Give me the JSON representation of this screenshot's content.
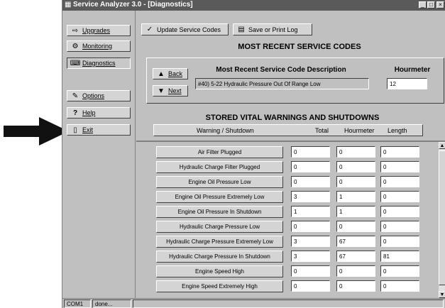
{
  "window": {
    "title": "Service Analyzer 3.0 - [Diagnostics]",
    "controls": [
      "_",
      "□",
      "×"
    ]
  },
  "sidebar": {
    "items": [
      {
        "label": "Upgrades",
        "icon": "upgrade-icon"
      },
      {
        "label": "Monitoring",
        "icon": "monitoring-icon"
      },
      {
        "label": "Diagnostics",
        "icon": "diagnostics-icon",
        "active": true
      },
      {
        "label": "Options",
        "icon": "options-icon"
      },
      {
        "label": "Help",
        "icon": "help-icon"
      },
      {
        "label": "Exit",
        "icon": "exit-icon"
      }
    ]
  },
  "toolbar": {
    "update_label": "Update Service Codes",
    "save_label": "Save or Print Log"
  },
  "codes": {
    "title": "MOST RECENT SERVICE CODES",
    "description_header": "Most Recent Service Code Description",
    "hourmeter_header": "Hourmeter",
    "back_label": "Back",
    "next_label": "Next",
    "description_value": "#40)  5-22  Hydraulic Pressure Out Of Range Low",
    "hourmeter_value": "12"
  },
  "warnings": {
    "title": "STORED VITAL WARNINGS AND SHUTDOWNS",
    "columns": [
      "Warning / Shutdown",
      "Total",
      "Hourmeter",
      "Length"
    ],
    "rows": [
      {
        "name": "Air Filter Plugged",
        "total": "0",
        "hourmeter": "0",
        "length": "0"
      },
      {
        "name": "Hydraulic Charge Filter Plugged",
        "total": "0",
        "hourmeter": "0",
        "length": "0"
      },
      {
        "name": "Engine Oil Pressure Low",
        "total": "0",
        "hourmeter": "0",
        "length": "0"
      },
      {
        "name": "Engine Oil Pressure Extremely Low",
        "total": "3",
        "hourmeter": "1",
        "length": "0"
      },
      {
        "name": "Engine Oil Pressure In Shutdown",
        "total": "1",
        "hourmeter": "1",
        "length": "0"
      },
      {
        "name": "Hydraulic Charge Pressure Low",
        "total": "0",
        "hourmeter": "0",
        "length": "0"
      },
      {
        "name": "Hydraulic Charge Pressure Extremely Low",
        "total": "3",
        "hourmeter": "67",
        "length": "0"
      },
      {
        "name": "Hydraulic Charge Pressure In Shutdown",
        "total": "3",
        "hourmeter": "67",
        "length": "81"
      },
      {
        "name": "Engine Speed High",
        "total": "0",
        "hourmeter": "0",
        "length": "0"
      },
      {
        "name": "Engine Speed Extremely High",
        "total": "0",
        "hourmeter": "0",
        "length": "0"
      }
    ]
  },
  "status": {
    "port": "COM1",
    "state": "done..."
  }
}
